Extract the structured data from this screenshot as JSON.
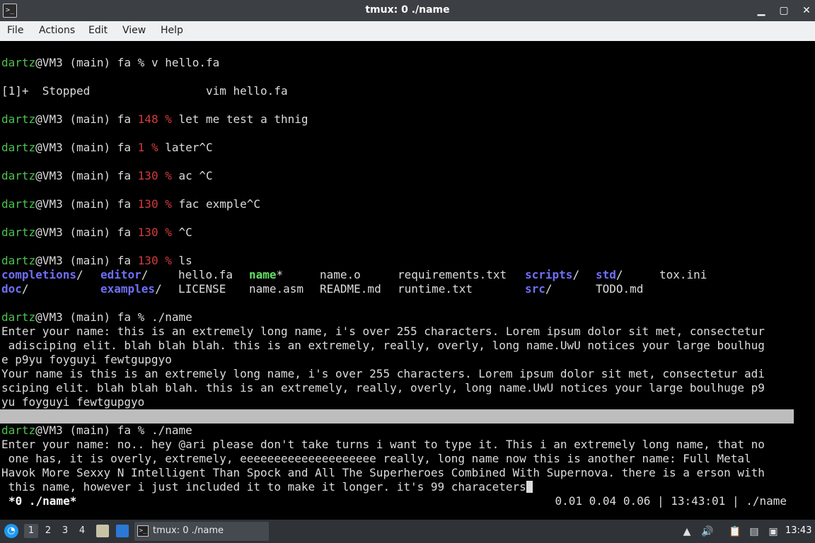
{
  "window": {
    "title": "tmux: 0 ./name",
    "app_icon": ">_",
    "minimize": "▁",
    "maximize": "▢",
    "close": "✕"
  },
  "menu": [
    "File",
    "Actions",
    "Edit",
    "View",
    "Help"
  ],
  "prompt": {
    "user": "dartz",
    "host_tail": "@VM3 (main) fa ",
    "sep": "% "
  },
  "lines": {
    "l1_cmd": "v hello.fa",
    "l2_stopped": "[1]+  Stopped                 vim hello.fa",
    "l3_code": "148 ",
    "l3_sep": "% ",
    "l3_cmd": "let me test a thnig",
    "l4_code": "1 ",
    "l4_sep": "% ",
    "l4_cmd": "later^C",
    "l5_code": "130 ",
    "l5_sep": "% ",
    "l5_cmd": "ac ^C",
    "l6_code": "130 ",
    "l6_sep": "% ",
    "l6_cmd": "fac exmple^C",
    "l7_code": "130 ",
    "l7_sep": "% ",
    "l7_cmd": "^C",
    "l8_code": "130 ",
    "l8_sep": "% ",
    "l8_cmd": "ls"
  },
  "ls": {
    "row1": [
      {
        "name": "completions",
        "suffix": "/",
        "kind": "dir"
      },
      {
        "name": "editor",
        "suffix": "/",
        "kind": "dir"
      },
      {
        "name": "hello.fa",
        "suffix": "",
        "kind": "plain"
      },
      {
        "name": "name",
        "suffix": "*",
        "kind": "exec"
      },
      {
        "name": "name.o",
        "suffix": "",
        "kind": "plain"
      },
      {
        "name": "requirements.txt",
        "suffix": "",
        "kind": "plain"
      },
      {
        "name": "scripts",
        "suffix": "/",
        "kind": "dir"
      },
      {
        "name": "std",
        "suffix": "/",
        "kind": "dir"
      },
      {
        "name": "tox.ini",
        "suffix": "",
        "kind": "plain"
      }
    ],
    "row2": [
      {
        "name": "doc",
        "suffix": "/",
        "kind": "dir"
      },
      {
        "name": "examples",
        "suffix": "/",
        "kind": "dir"
      },
      {
        "name": "LICENSE",
        "suffix": "",
        "kind": "plain"
      },
      {
        "name": "name.asm",
        "suffix": "",
        "kind": "plain"
      },
      {
        "name": "README.md",
        "suffix": "",
        "kind": "plain"
      },
      {
        "name": "runtime.txt",
        "suffix": "",
        "kind": "plain"
      },
      {
        "name": "src",
        "suffix": "/",
        "kind": "dir"
      },
      {
        "name": "TODO.md",
        "suffix": "",
        "kind": "plain"
      }
    ]
  },
  "run1": {
    "cmd": "./name",
    "out1": "Enter your name: this is an extremely long name, i's over 255 characters. Lorem ipsum dolor sit met, consectetur",
    "out2": " adisciping elit. blah blah blah. this is an extremely, really, overly, long name.UwU notices your large boulhug",
    "out3": "e p9yu foyguyi fewtgupgyo",
    "out4": "Your name is this is an extremely long name, i's over 255 characters. Lorem ipsum dolor sit met, consectetur adi",
    "out5": "sciping elit. blah blah blah. this is an extremely, really, overly, long name.UwU notices your large boulhuge p9",
    "out6": "yu foyguyi fewtgupgyo"
  },
  "run2": {
    "cmd": "./name",
    "out1": "Enter your name: no.. hey @ari please don't take turns i want to type it. This i an extremely long name, that no",
    "out2": " one has, it is overly, extremely, eeeeeeeeeeeeeeeeeeee really, long name now this is another name: Full Metal",
    "out3": "Havok More Sexxy N Intelligent Than Spock and All The Superheroes Combined With Supernova. there is a erson with",
    "out4": " this name, however i just included it to make it longer. it's 99 characeters"
  },
  "tmux_status": {
    "left": "*0 ./name*",
    "right": "0.01 0.04 0.06 | 13:43:01 | ./name"
  },
  "taskbar": {
    "start_icon": "◔",
    "workspaces": [
      "1",
      "2",
      "3",
      "4"
    ],
    "task_icon": ">_",
    "task_label": "tmux: 0 ./name",
    "tray_up": "▲",
    "tray_volume": "🔊",
    "tray_clipboard": "📋",
    "tray_network": "▤",
    "tray_display": "▣",
    "clock": "13:43"
  },
  "colors": {
    "prompt_user": "#4ec24e",
    "exit_code": "#d73a3a",
    "directory": "#6f6ff7",
    "executable": "#63e063"
  }
}
